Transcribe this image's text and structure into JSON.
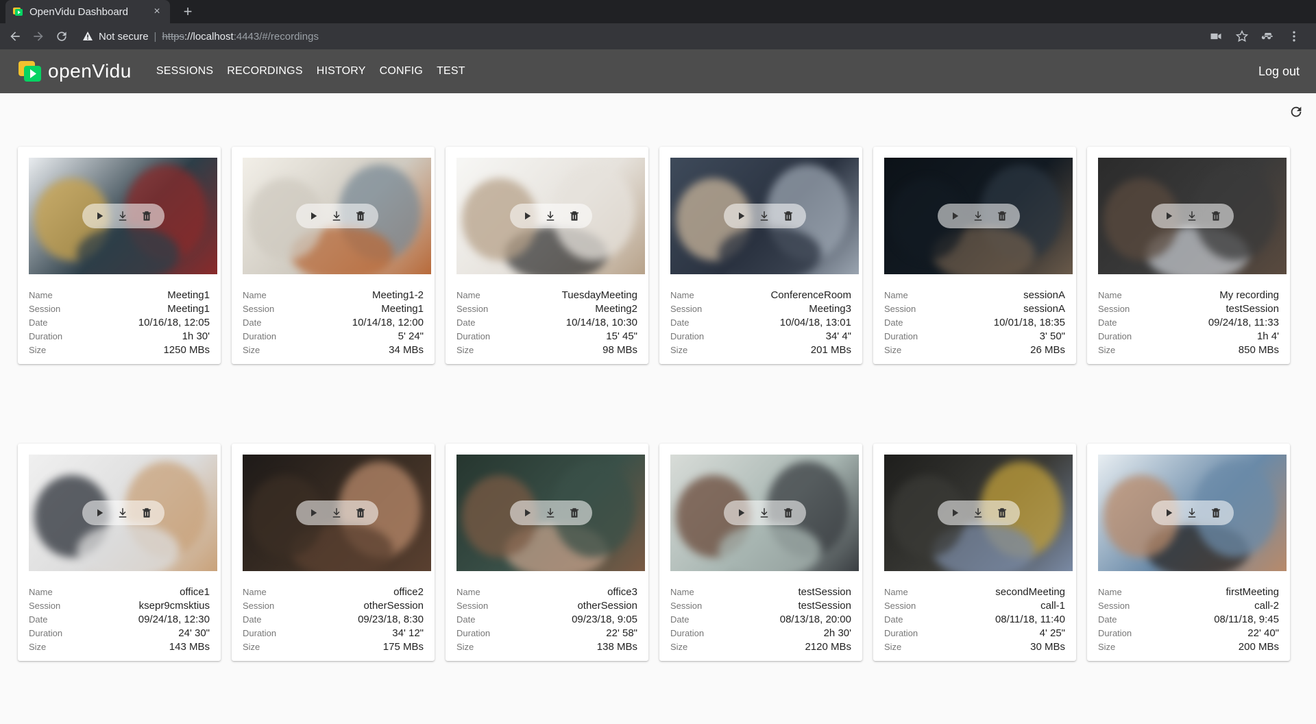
{
  "browser": {
    "tab_title": "OpenVidu Dashboard",
    "tab_close": "×",
    "new_tab": "+",
    "not_secure": "Not secure",
    "separator": "|",
    "url_scheme": "https",
    "url_host": "://localhost",
    "url_rest": ":4443/#/recordings"
  },
  "app": {
    "logo_text": "openVidu",
    "nav": [
      "SESSIONS",
      "RECORDINGS",
      "HISTORY",
      "CONFIG",
      "TEST"
    ],
    "logout": "Log out"
  },
  "labels": {
    "name": "Name",
    "session": "Session",
    "date": "Date",
    "duration": "Duration",
    "size": "Size"
  },
  "recordings": [
    {
      "name": "Meeting1",
      "session": "Meeting1",
      "date": "10/16/18, 12:05",
      "duration": "1h 30'",
      "size": "1250 MBs",
      "palette": [
        "#2d3e48",
        "#c9a24a",
        "#8a2a2a",
        "#e9ecef"
      ]
    },
    {
      "name": "Meeting1-2",
      "session": "Meeting1",
      "date": "10/14/18, 12:00",
      "duration": "5' 24\"",
      "size": "34 MBs",
      "palette": [
        "#cfcac0",
        "#7a8a96",
        "#b86a3a",
        "#f2efe8"
      ]
    },
    {
      "name": "TuesdayMeeting",
      "session": "Meeting2",
      "date": "10/14/18, 10:30",
      "duration": "15' 45\"",
      "size": "98 MBs",
      "palette": [
        "#e6e2dc",
        "#3a3a3a",
        "#b7a28a",
        "#f7f7f5"
      ]
    },
    {
      "name": "ConferenceRoom",
      "session": "Meeting3",
      "date": "10/04/18, 13:01",
      "duration": "34' 4\"",
      "size": "201 MBs",
      "palette": [
        "#2a3240",
        "#c8b49a",
        "#9aa4b0",
        "#3e4a5a"
      ]
    },
    {
      "name": "sessionA",
      "session": "sessionA",
      "date": "10/01/18, 18:35",
      "duration": "3' 50\"",
      "size": "26 MBs",
      "palette": [
        "#121a22",
        "#2a3540",
        "#6a5a4a",
        "#0c1218"
      ]
    },
    {
      "name": "My recording",
      "session": "testSession",
      "date": "09/24/18, 11:33",
      "duration": "1h 4'",
      "size": "850 MBs",
      "palette": [
        "#3a3a3a",
        "#c2c6cc",
        "#5a4a3e",
        "#2b2b2b"
      ]
    },
    {
      "name": "office1",
      "session": "ksepr9cmsktius",
      "date": "09/24/18, 12:30",
      "duration": "24' 30\"",
      "size": "143 MBs",
      "palette": [
        "#dcdcdc",
        "#2b3038",
        "#c9a27a",
        "#f0f0f0"
      ]
    },
    {
      "name": "office2",
      "session": "otherSession",
      "date": "09/23/18, 8:30",
      "duration": "34' 12\"",
      "size": "175 MBs",
      "palette": [
        "#3b2e24",
        "#b8896a",
        "#5a4030",
        "#1e1a18"
      ]
    },
    {
      "name": "office3",
      "session": "otherSession",
      "date": "09/23/18, 9:05",
      "duration": "22' 58\"",
      "size": "138 MBs",
      "palette": [
        "#3a5048",
        "#c2a08a",
        "#7a5a44",
        "#26362f"
      ]
    },
    {
      "name": "testSession",
      "session": "testSession",
      "date": "08/13/18, 20:00",
      "duration": "2h 30'",
      "size": "2120 MBs",
      "palette": [
        "#a8b6b2",
        "#6a4a3a",
        "#3a3e42",
        "#d8dcd8"
      ]
    },
    {
      "name": "secondMeeting",
      "session": "call-1",
      "date": "08/11/18, 11:40",
      "duration": "4' 25\"",
      "size": "30 MBs",
      "palette": [
        "#3a3a36",
        "#c2a03a",
        "#7a8aa4",
        "#1e1e1c"
      ]
    },
    {
      "name": "firstMeeting",
      "session": "call-2",
      "date": "08/11/18, 9:45",
      "duration": "22' 40\"",
      "size": "200 MBs",
      "palette": [
        "#6a8aa8",
        "#2a2624",
        "#b88a6a",
        "#e8eef2"
      ]
    }
  ]
}
